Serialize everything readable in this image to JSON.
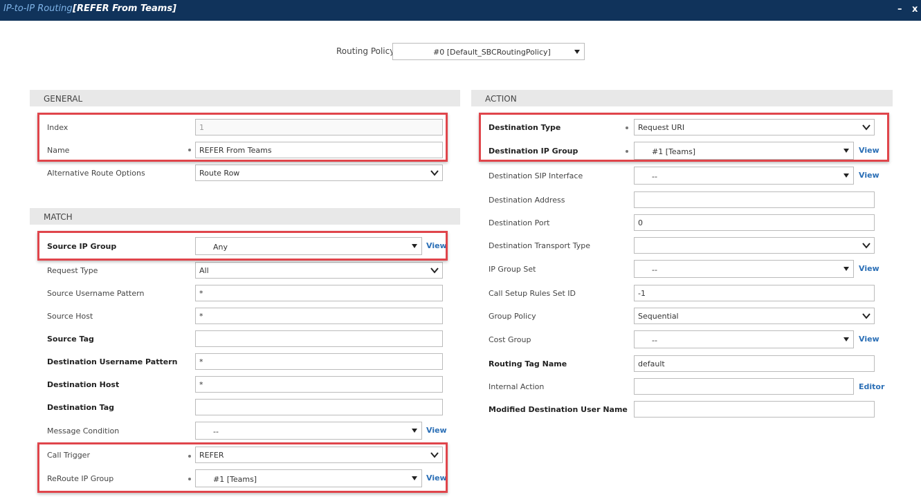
{
  "window": {
    "title_prefix": "IP-to-IP Routing",
    "title_name": "[REFER From Teams]",
    "minimize": "–",
    "close": "x"
  },
  "routing_policy": {
    "label": "Routing Policy",
    "value": "#0 [Default_SBCRoutingPolicy]"
  },
  "general": {
    "header": "GENERAL",
    "index_label": "Index",
    "index_value": "1",
    "name_label": "Name",
    "name_value": "REFER From Teams",
    "alt_label": "Alternative Route Options",
    "alt_value": "Route Row"
  },
  "match": {
    "header": "MATCH",
    "source_ip_group_label": "Source IP Group",
    "source_ip_group_value": "Any",
    "request_type_label": "Request Type",
    "request_type_value": "All",
    "source_username_label": "Source Username Pattern",
    "source_username_value": "*",
    "source_host_label": "Source Host",
    "source_host_value": "*",
    "source_tag_label": "Source Tag",
    "source_tag_value": "",
    "dest_username_label": "Destination Username Pattern",
    "dest_username_value": "*",
    "dest_host_label": "Destination Host",
    "dest_host_value": "*",
    "dest_tag_label": "Destination Tag",
    "dest_tag_value": "",
    "message_condition_label": "Message Condition",
    "message_condition_value": "--",
    "call_trigger_label": "Call Trigger",
    "call_trigger_value": "REFER",
    "reroute_label": "ReRoute IP Group",
    "reroute_value": "#1 [Teams]"
  },
  "action": {
    "header": "ACTION",
    "dest_type_label": "Destination Type",
    "dest_type_value": "Request URI",
    "dest_ip_group_label": "Destination IP Group",
    "dest_ip_group_value": "#1 [Teams]",
    "dest_sip_if_label": "Destination SIP Interface",
    "dest_sip_if_value": "--",
    "dest_address_label": "Destination Address",
    "dest_address_value": "",
    "dest_port_label": "Destination Port",
    "dest_port_value": "0",
    "dest_transport_label": "Destination Transport Type",
    "dest_transport_value": "",
    "ip_group_set_label": "IP Group Set",
    "ip_group_set_value": "--",
    "call_setup_label": "Call Setup Rules Set ID",
    "call_setup_value": "-1",
    "group_policy_label": "Group Policy",
    "group_policy_value": "Sequential",
    "cost_group_label": "Cost Group",
    "cost_group_value": "--",
    "routing_tag_label": "Routing Tag Name",
    "routing_tag_value": "default",
    "internal_action_label": "Internal Action",
    "internal_action_value": "",
    "modified_dest_label": "Modified Destination User Name",
    "modified_dest_value": ""
  },
  "links": {
    "view": "View",
    "editor": "Editor"
  },
  "colors": {
    "title_bg": "#10335b",
    "highlight": "#e0454b",
    "link": "#2b6fb6",
    "section_bg": "#e8e8e8"
  }
}
